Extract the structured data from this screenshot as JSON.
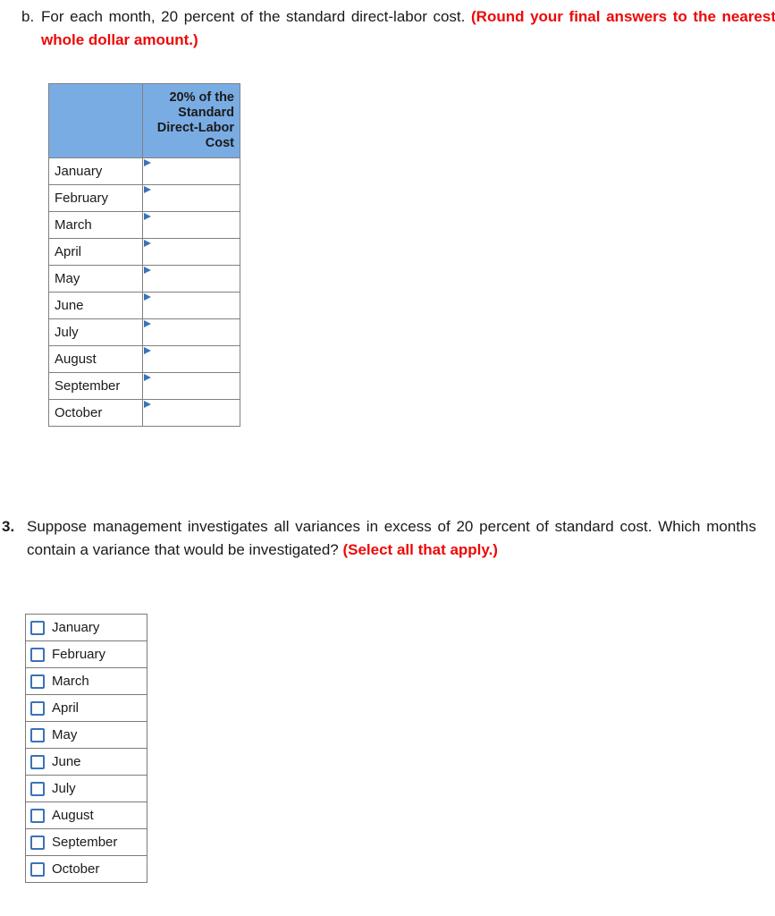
{
  "colors": {
    "header_blue": "#7aace4",
    "marker_blue": "#3a72b8",
    "instruction_red": "#ee0808",
    "border_gray": "#808080",
    "page_background": "#ffffff"
  },
  "question_b": {
    "marker": "b.",
    "text": "For each month, 20 percent of the standard direct-labor cost.",
    "instruction": "(Round your final answers to the nearest whole dollar amount.)"
  },
  "entry_table": {
    "headers": {
      "label_column": "",
      "value_column": "20% of the Standard Direct-Labor Cost"
    },
    "rows": [
      {
        "month": "January",
        "value": ""
      },
      {
        "month": "February",
        "value": ""
      },
      {
        "month": "March",
        "value": ""
      },
      {
        "month": "April",
        "value": ""
      },
      {
        "month": "May",
        "value": ""
      },
      {
        "month": "June",
        "value": ""
      },
      {
        "month": "July",
        "value": ""
      },
      {
        "month": "August",
        "value": ""
      },
      {
        "month": "September",
        "value": ""
      },
      {
        "month": "October",
        "value": ""
      }
    ]
  },
  "question_3": {
    "marker": "3.",
    "text": "Suppose management investigates all variances in excess of 20 percent of standard cost. Which months contain a variance that would be investigated?",
    "instruction": "(Select all that apply.)"
  },
  "checkbox_list": {
    "items": [
      {
        "label": "January",
        "checked": false
      },
      {
        "label": "February",
        "checked": false
      },
      {
        "label": "March",
        "checked": false
      },
      {
        "label": "April",
        "checked": false
      },
      {
        "label": "May",
        "checked": false
      },
      {
        "label": "June",
        "checked": false
      },
      {
        "label": "July",
        "checked": false
      },
      {
        "label": "August",
        "checked": false
      },
      {
        "label": "September",
        "checked": false
      },
      {
        "label": "October",
        "checked": false
      }
    ]
  }
}
